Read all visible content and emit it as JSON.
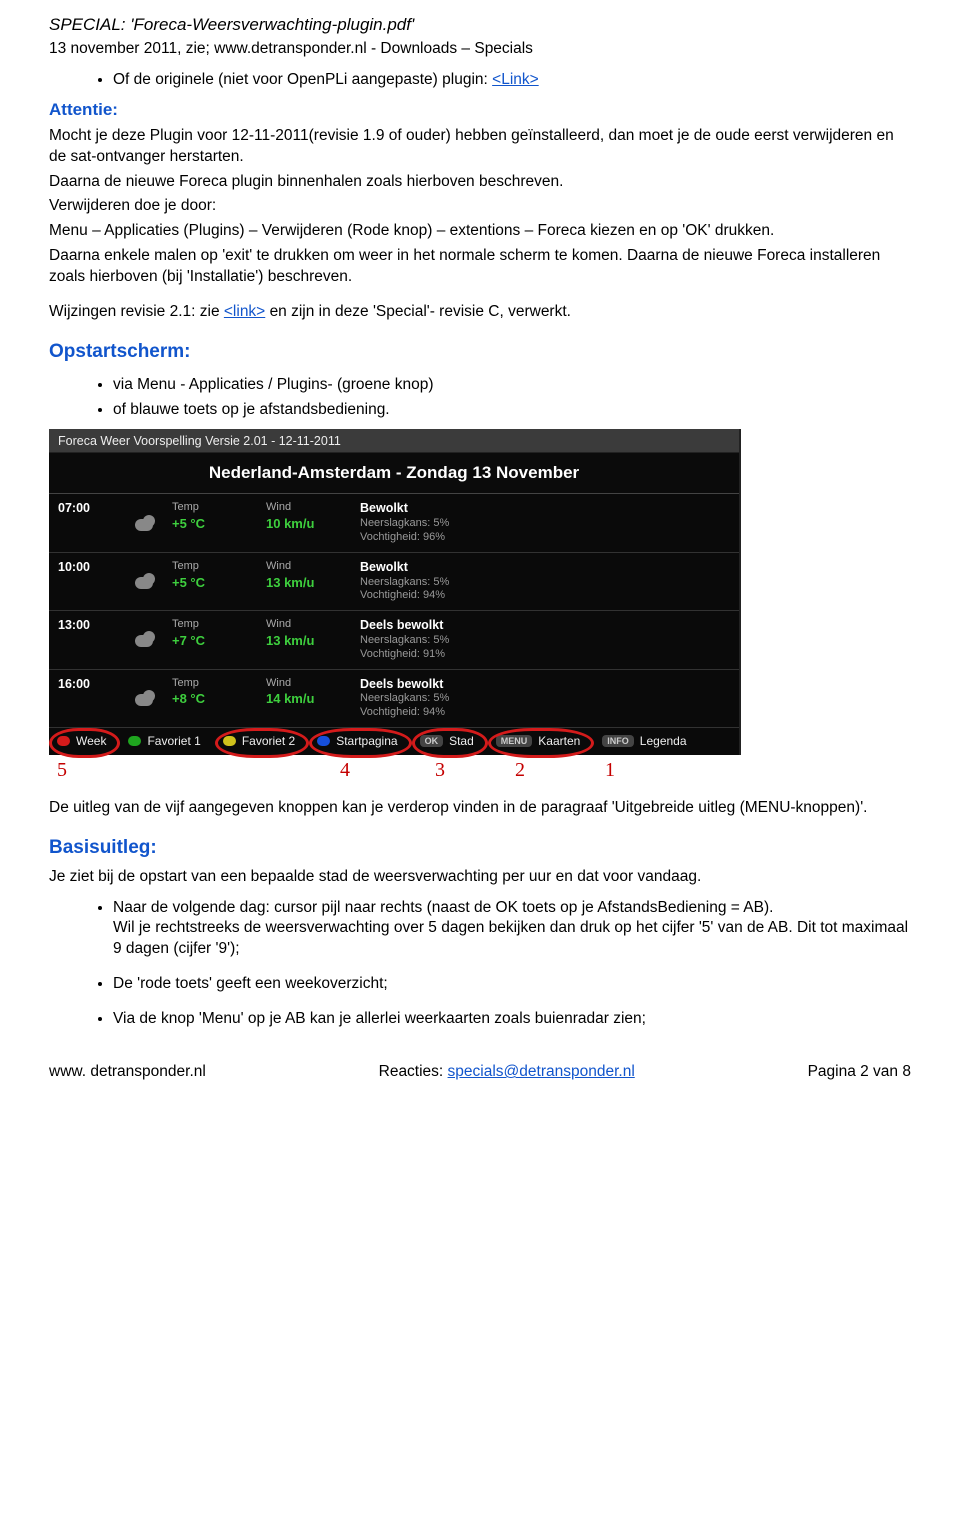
{
  "doc_header": {
    "title": "SPECIAL: 'Foreca-Weersverwachting-plugin.pdf'",
    "subtitle": "13 november 2011, zie; www.detransponder.nl - Downloads – Specials"
  },
  "intro_bullet": "Of de originele (niet voor OpenPLi aangepaste) plugin: ",
  "intro_link": "<Link>",
  "attentie": {
    "label": "Attentie:",
    "p1a": "Mocht je deze Plugin voor 12-11-2011(revisie 1.9 of ouder) hebben geïnstalleerd, dan moet je de oude eerst verwijderen en de sat-ontvanger herstarten.",
    "p1b": "Daarna de nieuwe Foreca plugin binnenhalen zoals hierboven beschreven.",
    "p2a": "Verwijderen doe je door:",
    "p2b": "Menu – Applicaties (Plugins) – Verwijderen (Rode knop) – extentions – Foreca kiezen en op 'OK' drukken.",
    "p2c": "Daarna enkele malen op 'exit' te drukken om weer in het normale scherm te komen. Daarna de nieuwe Foreca installeren zoals hierboven (bij 'Installatie') beschreven.",
    "p3a": "Wijzingen revisie 2.1: zie  ",
    "p3_link": "<link>",
    "p3b": " en zijn in deze 'Special'- revisie C, verwerkt."
  },
  "opstart": {
    "heading": "Opstartscherm:",
    "b1": "via Menu - Applicaties / Plugins- (groene knop)",
    "b2": "of blauwe toets op je afstandsbediening."
  },
  "scr": {
    "topbar": "Foreca Weer Voorspelling   Versie 2.01 - 12-11-2011",
    "loc": "Nederland-Amsterdam  -  Zondag 13 November",
    "temp_label": "Temp",
    "wind_label": "Wind",
    "rows": [
      {
        "hour": "07:00",
        "temp": "+5 °C",
        "wind": "10 km/u",
        "title": "Bewolkt",
        "s1": "Neerslagkans: 5%",
        "s2": "Vochtigheid: 96%"
      },
      {
        "hour": "10:00",
        "temp": "+5 °C",
        "wind": "13 km/u",
        "title": "Bewolkt",
        "s1": "Neerslagkans: 5%",
        "s2": "Vochtigheid: 94%"
      },
      {
        "hour": "13:00",
        "temp": "+7 °C",
        "wind": "13 km/u",
        "title": "Deels bewolkt",
        "s1": "Neerslagkans: 5%",
        "s2": "Vochtigheid: 91%"
      },
      {
        "hour": "16:00",
        "temp": "+8 °C",
        "wind": "14 km/u",
        "title": "Deels bewolkt",
        "s1": "Neerslagkans: 5%",
        "s2": "Vochtigheid: 94%"
      }
    ],
    "buttons": {
      "red": "Week",
      "green": "Favoriet 1",
      "yellow": "Favoriet 2",
      "blue": "Startpagina",
      "ok_key": "OK",
      "ok": "Stad",
      "menu_key": "MENU",
      "menu": "Kaarten",
      "info_key": "INFO",
      "info": "Legenda"
    }
  },
  "hand": {
    "n5": "5",
    "n4": "4",
    "n3": "3",
    "n2": "2",
    "n1": "1"
  },
  "after_scr": "De uitleg van de  vijf aangegeven knoppen kan je verderop vinden in de paragraaf 'Uitgebreide uitleg (MENU-knoppen)'.",
  "basis": {
    "heading": "Basisuitleg:",
    "intro": "Je ziet bij de opstart van een bepaalde stad de weersverwachting per uur en dat voor vandaag.",
    "b1a": "Naar de volgende dag: cursor pijl naar rechts (naast de OK toets op je AfstandsBediening = AB).",
    "b1b": "Wil je rechtstreeks de weersverwachting over 5 dagen bekijken dan druk op het cijfer '5' van de AB. Dit tot maximaal 9 dagen (cijfer '9');",
    "b2": "De 'rode toets' geeft een weekoverzicht;",
    "b3": "Via de knop 'Menu' op je AB kan je allerlei weerkaarten zoals buienradar zien;"
  },
  "footer": {
    "site": "www. detransponder.nl",
    "react_label": "Reacties: ",
    "react_link": "specials@detransponder.nl",
    "page": "Pagina 2 van 8"
  }
}
